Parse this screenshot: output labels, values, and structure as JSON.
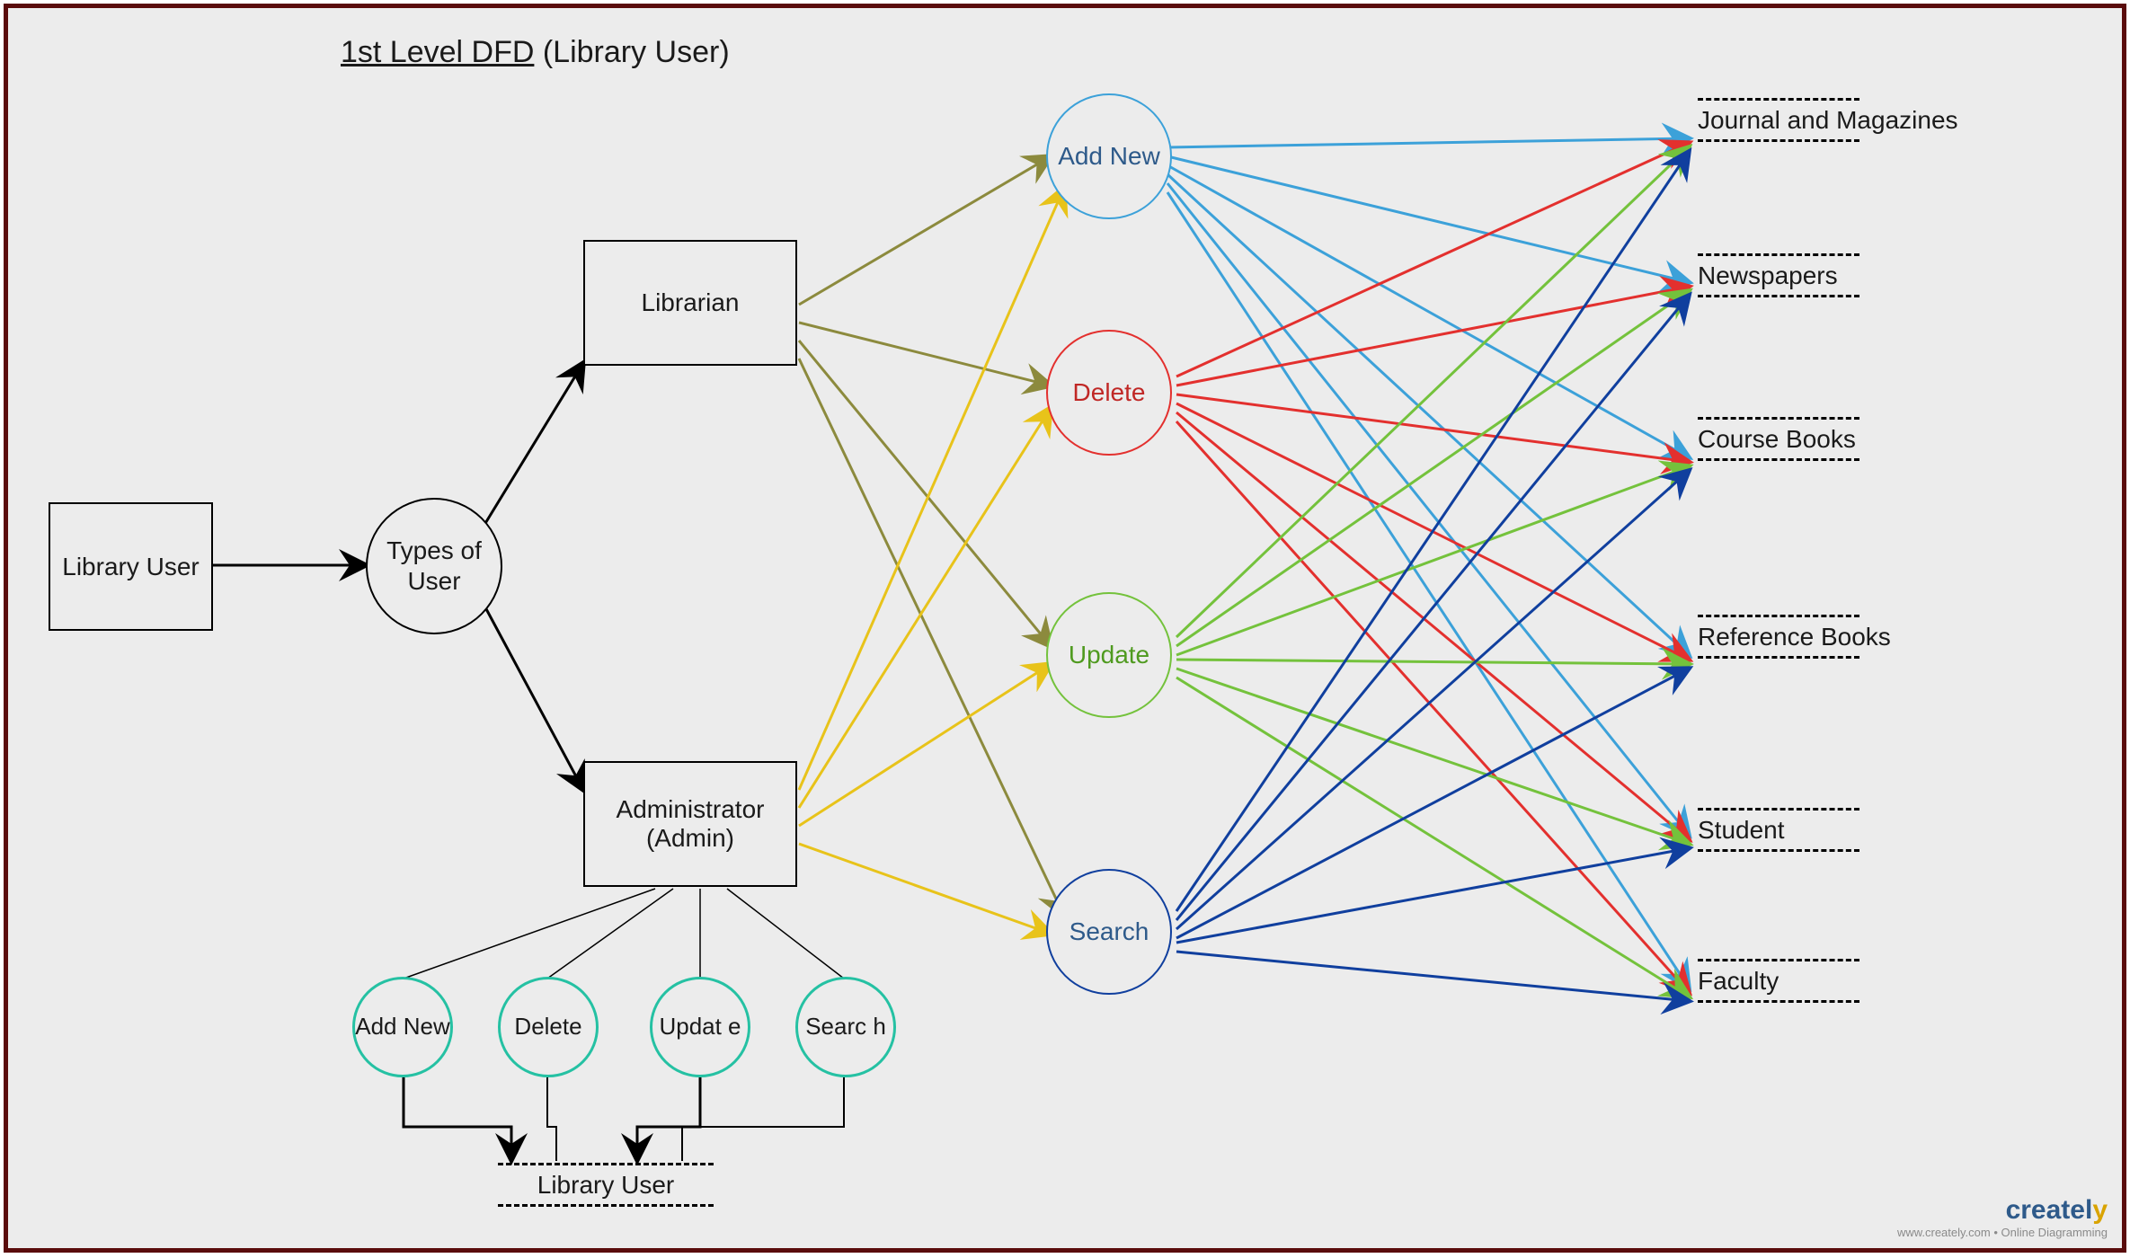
{
  "title_underlined": "1st Level DFD",
  "title_rest": "(Library User)",
  "nodes": {
    "library_user": "Library User",
    "types_of_user": "Types of User",
    "librarian": "Librarian",
    "administrator": "Administrator (Admin)",
    "add_new": "Add New",
    "delete": "Delete",
    "update": "Update",
    "search": "Search",
    "admin_add_new": "Add New",
    "admin_delete": "Delete",
    "admin_update": "Updat e",
    "admin_search": "Searc h",
    "admin_target": "Library User"
  },
  "stores": {
    "journal_magazines": "Journal and Magazines",
    "newspapers": "Newspapers",
    "course_books": "Course Books",
    "reference_books": "Reference Books",
    "student": "Student",
    "faculty": "Faculty"
  },
  "colors": {
    "olive": "#8c8a3d",
    "yellow": "#e8c31a",
    "sky": "#3ca1d9",
    "red": "#e3302e",
    "green": "#74c23c",
    "navy": "#103f9e",
    "teal": "#25c1a3",
    "black": "#000000"
  },
  "brand": {
    "name_main": "createl",
    "name_y": "y",
    "tagline": "www.creately.com • Online Diagramming"
  }
}
